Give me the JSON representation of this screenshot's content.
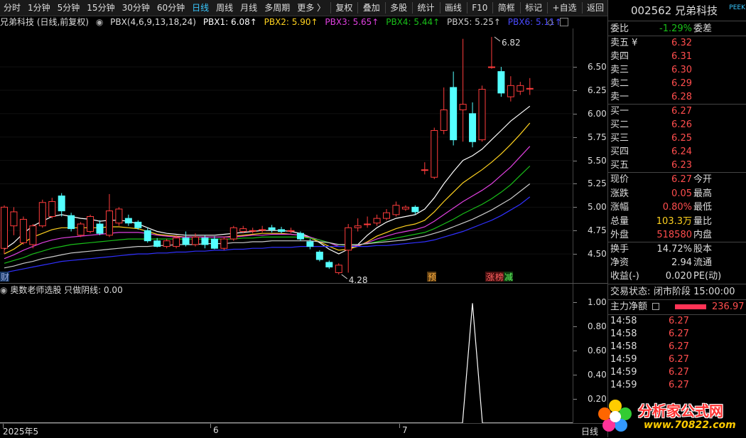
{
  "toolbar": {
    "items": [
      "分时",
      "1分钟",
      "5分钟",
      "15分钟",
      "30分钟",
      "60分钟",
      "日线",
      "周线",
      "月线",
      "多周期",
      "更多 〉"
    ],
    "active": "日线",
    "right_items": [
      "复权",
      "叠加",
      "多股",
      "统计",
      "画线",
      "F10",
      "简框",
      "标记",
      "+自选",
      "返回"
    ]
  },
  "header": {
    "name": "兄弟科技 (日线,前复权)",
    "indicator": "PBX(4,6,9,13,18,24)",
    "pbx1": "PBX1: 6.08↑",
    "pbx2": "PBX2: 5.90↑",
    "pbx3": "PBX3: 5.65↑",
    "pbx4": "PBX4: 5.44↑",
    "pbx5": "PBX5: 5.25↑",
    "pbx6": "PBX6: 5.11↑",
    "pbx_colors": [
      "#ffffff",
      "#ffd21f",
      "#e040e0",
      "#19c019",
      "#cccccc",
      "#3030ff"
    ]
  },
  "sub_header": {
    "title": "奥数老师选股 只做阴线: 0.00"
  },
  "chart_annotations": {
    "high_label": "6.82",
    "low_label": "4.28",
    "marker_cai": "财",
    "marker_yu": "预",
    "marker_zhang": "涨",
    "marker_bang": "榜",
    "marker_jian": "减"
  },
  "y_axis_main": [
    "6.50",
    "6.25",
    "6.00",
    "5.75",
    "5.50",
    "5.25",
    "5.00",
    "4.75",
    "4.50"
  ],
  "y_axis_sub": [
    "1.00",
    "0.80",
    "0.60",
    "0.40",
    "0.20"
  ],
  "x_axis": {
    "labels": [
      "2025年5",
      "6",
      "7"
    ],
    "period": "日线"
  },
  "chart_data": {
    "type": "candlestick",
    "y_range": [
      4.25,
      6.85
    ],
    "candles": [
      {
        "o": 4.56,
        "c": 5.0,
        "h": 5.02,
        "l": 4.5
      },
      {
        "o": 4.8,
        "c": 4.95,
        "h": 5.0,
        "l": 4.7
      },
      {
        "o": 4.62,
        "c": 4.87,
        "h": 4.9,
        "l": 4.6
      },
      {
        "o": 4.6,
        "c": 4.8,
        "h": 4.82,
        "l": 4.56
      },
      {
        "o": 4.8,
        "c": 5.05,
        "h": 5.08,
        "l": 4.78
      },
      {
        "o": 4.9,
        "c": 5.06,
        "h": 5.1,
        "l": 4.88
      },
      {
        "o": 5.12,
        "c": 4.96,
        "h": 5.15,
        "l": 4.9
      },
      {
        "o": 4.91,
        "c": 4.77,
        "h": 4.94,
        "l": 4.74
      },
      {
        "o": 4.7,
        "c": 4.82,
        "h": 4.84,
        "l": 4.68
      },
      {
        "o": 4.74,
        "c": 4.9,
        "h": 4.92,
        "l": 4.72
      },
      {
        "o": 4.82,
        "c": 4.72,
        "h": 4.86,
        "l": 4.7
      },
      {
        "o": 4.7,
        "c": 4.96,
        "h": 5.14,
        "l": 4.68
      },
      {
        "o": 4.83,
        "c": 4.98,
        "h": 5.0,
        "l": 4.8
      },
      {
        "o": 4.88,
        "c": 4.83,
        "h": 4.92,
        "l": 4.8
      },
      {
        "o": 4.84,
        "c": 4.78,
        "h": 4.86,
        "l": 4.76
      },
      {
        "o": 4.75,
        "c": 4.64,
        "h": 4.78,
        "l": 4.62
      },
      {
        "o": 4.64,
        "c": 4.58,
        "h": 4.67,
        "l": 4.57
      },
      {
        "o": 4.58,
        "c": 4.64,
        "h": 4.66,
        "l": 4.56
      },
      {
        "o": 4.58,
        "c": 4.67,
        "h": 4.7,
        "l": 4.56
      },
      {
        "o": 4.67,
        "c": 4.6,
        "h": 4.74,
        "l": 4.58
      },
      {
        "o": 4.6,
        "c": 4.68,
        "h": 4.72,
        "l": 4.58
      },
      {
        "o": 4.67,
        "c": 4.6,
        "h": 4.7,
        "l": 4.56
      },
      {
        "o": 4.66,
        "c": 4.56,
        "h": 4.69,
        "l": 4.55
      },
      {
        "o": 4.56,
        "c": 4.66,
        "h": 4.68,
        "l": 4.54
      },
      {
        "o": 4.66,
        "c": 4.78,
        "h": 4.8,
        "l": 4.64
      },
      {
        "o": 4.74,
        "c": 4.77,
        "h": 4.8,
        "l": 4.72
      },
      {
        "o": 4.75,
        "c": 4.75,
        "h": 4.78,
        "l": 4.72
      },
      {
        "o": 4.76,
        "c": 4.76,
        "h": 4.8,
        "l": 4.73
      },
      {
        "o": 4.78,
        "c": 4.76,
        "h": 4.81,
        "l": 4.73
      },
      {
        "o": 4.76,
        "c": 4.74,
        "h": 4.79,
        "l": 4.72
      },
      {
        "o": 4.75,
        "c": 4.75,
        "h": 4.78,
        "l": 4.72
      },
      {
        "o": 4.72,
        "c": 4.66,
        "h": 4.74,
        "l": 4.64
      },
      {
        "o": 4.63,
        "c": 4.58,
        "h": 4.66,
        "l": 4.55
      },
      {
        "o": 4.52,
        "c": 4.44,
        "h": 4.54,
        "l": 4.42
      },
      {
        "o": 4.41,
        "c": 4.36,
        "h": 4.43,
        "l": 4.34
      },
      {
        "o": 4.3,
        "c": 4.38,
        "h": 4.4,
        "l": 4.28
      },
      {
        "o": 4.54,
        "c": 4.78,
        "h": 4.82,
        "l": 4.3
      },
      {
        "o": 4.78,
        "c": 4.8,
        "h": 4.88,
        "l": 4.74
      },
      {
        "o": 4.82,
        "c": 4.82,
        "h": 4.9,
        "l": 4.78
      },
      {
        "o": 4.83,
        "c": 4.88,
        "h": 4.92,
        "l": 4.8
      },
      {
        "o": 4.88,
        "c": 4.94,
        "h": 4.98,
        "l": 4.86
      },
      {
        "o": 4.92,
        "c": 5.02,
        "h": 5.06,
        "l": 4.9
      },
      {
        "o": 4.98,
        "c": 5.0,
        "h": 5.02,
        "l": 4.96
      },
      {
        "o": 5.0,
        "c": 4.95,
        "h": 5.02,
        "l": 4.92
      },
      {
        "o": 5.4,
        "c": 5.4,
        "h": 5.48,
        "l": 5.35
      },
      {
        "o": 5.32,
        "c": 5.82,
        "h": 5.85,
        "l": 5.3
      },
      {
        "o": 5.82,
        "c": 6.04,
        "h": 6.28,
        "l": 5.78
      },
      {
        "o": 6.28,
        "c": 5.72,
        "h": 6.45,
        "l": 5.66
      },
      {
        "o": 6.04,
        "c": 6.1,
        "h": 6.8,
        "l": 5.7
      },
      {
        "o": 6.0,
        "c": 5.7,
        "h": 6.12,
        "l": 5.64
      },
      {
        "o": 5.72,
        "c": 6.26,
        "h": 6.3,
        "l": 5.7
      },
      {
        "o": 6.5,
        "c": 6.5,
        "h": 6.82,
        "l": 6.48
      },
      {
        "o": 6.45,
        "c": 6.22,
        "h": 6.5,
        "l": 6.18
      },
      {
        "o": 6.18,
        "c": 6.3,
        "h": 6.4,
        "l": 6.13
      },
      {
        "o": 6.24,
        "c": 6.3,
        "h": 6.34,
        "l": 6.2
      },
      {
        "o": 6.27,
        "c": 6.27,
        "h": 6.38,
        "l": 6.2
      }
    ],
    "ma_lines": [
      {
        "name": "PBX1",
        "color": "#ffffff",
        "values": [
          4.55,
          4.62,
          4.72,
          4.8,
          4.85,
          4.9,
          4.92,
          4.9,
          4.88,
          4.87,
          4.85,
          4.86,
          4.86,
          4.85,
          4.82,
          4.78,
          4.74,
          4.72,
          4.71,
          4.7,
          4.7,
          4.7,
          4.7,
          4.71,
          4.72,
          4.73,
          4.74,
          4.75,
          4.75,
          4.75,
          4.74,
          4.72,
          4.68,
          4.62,
          4.55,
          4.5,
          4.55,
          4.6,
          4.7,
          4.78,
          4.84,
          4.88,
          4.9,
          4.92,
          4.98,
          5.1,
          5.25,
          5.38,
          5.5,
          5.55,
          5.62,
          5.72,
          5.82,
          5.92,
          6.0,
          6.08
        ]
      },
      {
        "name": "PBX2",
        "color": "#ffd21f",
        "values": [
          4.5,
          4.55,
          4.62,
          4.68,
          4.72,
          4.76,
          4.78,
          4.78,
          4.78,
          4.78,
          4.78,
          4.79,
          4.79,
          4.78,
          4.77,
          4.74,
          4.71,
          4.7,
          4.69,
          4.68,
          4.68,
          4.68,
          4.68,
          4.68,
          4.69,
          4.7,
          4.71,
          4.72,
          4.72,
          4.72,
          4.71,
          4.7,
          4.67,
          4.63,
          4.58,
          4.54,
          4.55,
          4.58,
          4.63,
          4.69,
          4.73,
          4.77,
          4.8,
          4.82,
          4.86,
          4.95,
          5.06,
          5.16,
          5.26,
          5.33,
          5.4,
          5.48,
          5.57,
          5.67,
          5.78,
          5.9
        ]
      },
      {
        "name": "PBX3",
        "color": "#e040e0",
        "values": [
          4.45,
          4.49,
          4.54,
          4.58,
          4.62,
          4.65,
          4.67,
          4.68,
          4.69,
          4.7,
          4.71,
          4.72,
          4.73,
          4.73,
          4.73,
          4.72,
          4.7,
          4.69,
          4.68,
          4.68,
          4.68,
          4.68,
          4.68,
          4.68,
          4.68,
          4.69,
          4.7,
          4.7,
          4.71,
          4.71,
          4.71,
          4.7,
          4.68,
          4.65,
          4.62,
          4.58,
          4.58,
          4.59,
          4.62,
          4.66,
          4.69,
          4.72,
          4.74,
          4.76,
          4.79,
          4.85,
          4.92,
          4.99,
          5.06,
          5.12,
          5.18,
          5.25,
          5.34,
          5.43,
          5.54,
          5.65
        ]
      },
      {
        "name": "PBX4",
        "color": "#19c019",
        "values": [
          4.4,
          4.43,
          4.46,
          4.5,
          4.53,
          4.56,
          4.58,
          4.6,
          4.61,
          4.62,
          4.63,
          4.64,
          4.65,
          4.66,
          4.66,
          4.66,
          4.66,
          4.66,
          4.66,
          4.66,
          4.66,
          4.66,
          4.66,
          4.66,
          4.66,
          4.67,
          4.67,
          4.68,
          4.68,
          4.68,
          4.68,
          4.68,
          4.67,
          4.65,
          4.62,
          4.6,
          4.59,
          4.6,
          4.61,
          4.63,
          4.65,
          4.67,
          4.69,
          4.71,
          4.73,
          4.77,
          4.82,
          4.87,
          4.93,
          4.98,
          5.03,
          5.09,
          5.16,
          5.24,
          5.34,
          5.44
        ]
      },
      {
        "name": "PBX5",
        "color": "#cccccc",
        "values": [
          4.35,
          4.37,
          4.4,
          4.42,
          4.45,
          4.47,
          4.49,
          4.51,
          4.52,
          4.53,
          4.54,
          4.55,
          4.56,
          4.57,
          4.58,
          4.58,
          4.59,
          4.59,
          4.6,
          4.6,
          4.6,
          4.61,
          4.61,
          4.61,
          4.62,
          4.62,
          4.63,
          4.63,
          4.64,
          4.64,
          4.64,
          4.64,
          4.64,
          4.63,
          4.62,
          4.6,
          4.6,
          4.6,
          4.61,
          4.62,
          4.63,
          4.64,
          4.65,
          4.67,
          4.69,
          4.72,
          4.75,
          4.79,
          4.83,
          4.87,
          4.92,
          4.97,
          5.03,
          5.09,
          5.17,
          5.25
        ]
      },
      {
        "name": "PBX6",
        "color": "#3030ff",
        "values": [
          4.3,
          4.32,
          4.34,
          4.36,
          4.38,
          4.4,
          4.42,
          4.43,
          4.44,
          4.45,
          4.46,
          4.47,
          4.48,
          4.49,
          4.5,
          4.5,
          4.51,
          4.51,
          4.52,
          4.52,
          4.53,
          4.53,
          4.54,
          4.54,
          4.55,
          4.55,
          4.56,
          4.56,
          4.57,
          4.57,
          4.57,
          4.58,
          4.58,
          4.58,
          4.58,
          4.58,
          4.58,
          4.58,
          4.58,
          4.59,
          4.59,
          4.6,
          4.61,
          4.62,
          4.63,
          4.65,
          4.68,
          4.71,
          4.74,
          4.78,
          4.82,
          4.86,
          4.91,
          4.97,
          5.03,
          5.11
        ]
      }
    ],
    "sub_signal": {
      "y_range": [
        0,
        1.05
      ],
      "spike_index": 49,
      "spike_value": 1.0
    }
  },
  "panel": {
    "title": "002562 兄弟科技",
    "weibi_label": "委比",
    "weibi_value": "-1.29%",
    "weicha_label": "委差",
    "asks": [
      {
        "label": "卖五 ¥",
        "price": "6.32"
      },
      {
        "label": "卖四",
        "price": "6.31"
      },
      {
        "label": "卖三",
        "price": "6.30"
      },
      {
        "label": "卖二",
        "price": "6.29"
      },
      {
        "label": "卖一",
        "price": "6.28"
      }
    ],
    "bids": [
      {
        "label": "买一",
        "price": "6.27"
      },
      {
        "label": "买二",
        "price": "6.26"
      },
      {
        "label": "买三",
        "price": "6.25"
      },
      {
        "label": "买四",
        "price": "6.24"
      },
      {
        "label": "买五",
        "price": "6.23"
      }
    ],
    "quotes": [
      {
        "label": "现价",
        "value": "6.27",
        "extra": "今开",
        "cls": "red"
      },
      {
        "label": "涨跌",
        "value": "0.05",
        "extra": "最高",
        "cls": "red"
      },
      {
        "label": "涨幅",
        "value": "0.80%",
        "extra": "最低",
        "cls": "red"
      },
      {
        "label": "总量",
        "value": "103.3万",
        "extra": "量比",
        "cls": "yellow"
      },
      {
        "label": "外盘",
        "value": "518580",
        "extra": "内盘",
        "cls": "red"
      }
    ],
    "stats": [
      {
        "label": "换手",
        "value": "14.72%",
        "extra": "股本"
      },
      {
        "label": "净资",
        "value": "2.94",
        "extra": "流通"
      },
      {
        "label": "收益(-)",
        "value": "0.020",
        "extra": "PE(动)"
      }
    ],
    "status_label": "交易状态:",
    "status_value": "闭市阶段 15:00:00",
    "net_label": "主力净额",
    "net_value": "236.97",
    "ticks": [
      {
        "time": "14:58",
        "price": "6.27"
      },
      {
        "time": "14:58",
        "price": "6.27"
      },
      {
        "time": "14:58",
        "price": "6.27"
      },
      {
        "time": "14:59",
        "price": "6.27"
      },
      {
        "time": "14:59",
        "price": "6.27"
      },
      {
        "time": "14:59",
        "price": "6.27"
      }
    ],
    "logo_text": "分析家公式网",
    "logo_url": "www.70822.com",
    "corner_tag": "PEEK"
  }
}
